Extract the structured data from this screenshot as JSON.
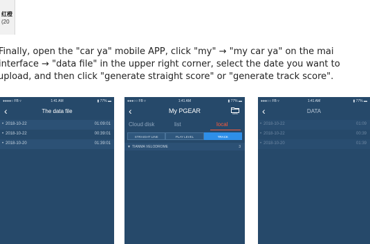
{
  "header_thumb": {
    "line1": "红橙",
    "line2": "(20"
  },
  "instructions": {
    "line1": "Finally, open the \"car ya\" mobile APP, click \"my\" → \"my car ya\" on the mai",
    "line2": "interface → \"data file\" in the upper right corner, select the date you want to",
    "line3": "upload, and then click \"generate straight score\" or \"generate track score\"."
  },
  "phones": {
    "data_file": {
      "status": {
        "signal": "●●●●○ FB ▿",
        "time": "1:41 AM",
        "battery": "▮ 77% ▬"
      },
      "back_glyph": "‹",
      "title": "The data file",
      "dot": "•",
      "rows": [
        {
          "date": "2018-10-22",
          "duration": "01:09:01"
        },
        {
          "date": "2018-10-22",
          "duration": "00:39:01"
        },
        {
          "date": "2018-10-20",
          "duration": "01:39:01"
        }
      ]
    },
    "pgear": {
      "status": {
        "signal": "●●●○○ FB ▿",
        "time": "1:41 AM",
        "battery": "▮ 77% ▬"
      },
      "back_glyph": "‹",
      "title": "My PGEAR",
      "icon_label": "DATA",
      "tabs": [
        "Cloud disk",
        "list",
        "local"
      ],
      "segments": [
        "STRAIGHT LINE",
        "PLAY LEVEL",
        "TRACK"
      ],
      "track": {
        "marker": "▼",
        "name": "TIANMA VELODROME",
        "count": "3"
      }
    },
    "data": {
      "status": {
        "signal": "●●●○○ FB ▿",
        "time": "1:41 AM",
        "battery": "▮ 77% ▬"
      },
      "back_glyph": "‹",
      "title": "DATA",
      "dot": "•",
      "rows": [
        {
          "date": "2018-10-22",
          "duration": "01:09"
        },
        {
          "date": "2018-10-22",
          "duration": "00:39"
        },
        {
          "date": "2018-10-20",
          "duration": "01:39"
        }
      ]
    }
  },
  "colors": {
    "phone_bg": "#26496a",
    "accent_local": "#ff5b3a",
    "segment_active": "#2e8fe8"
  }
}
